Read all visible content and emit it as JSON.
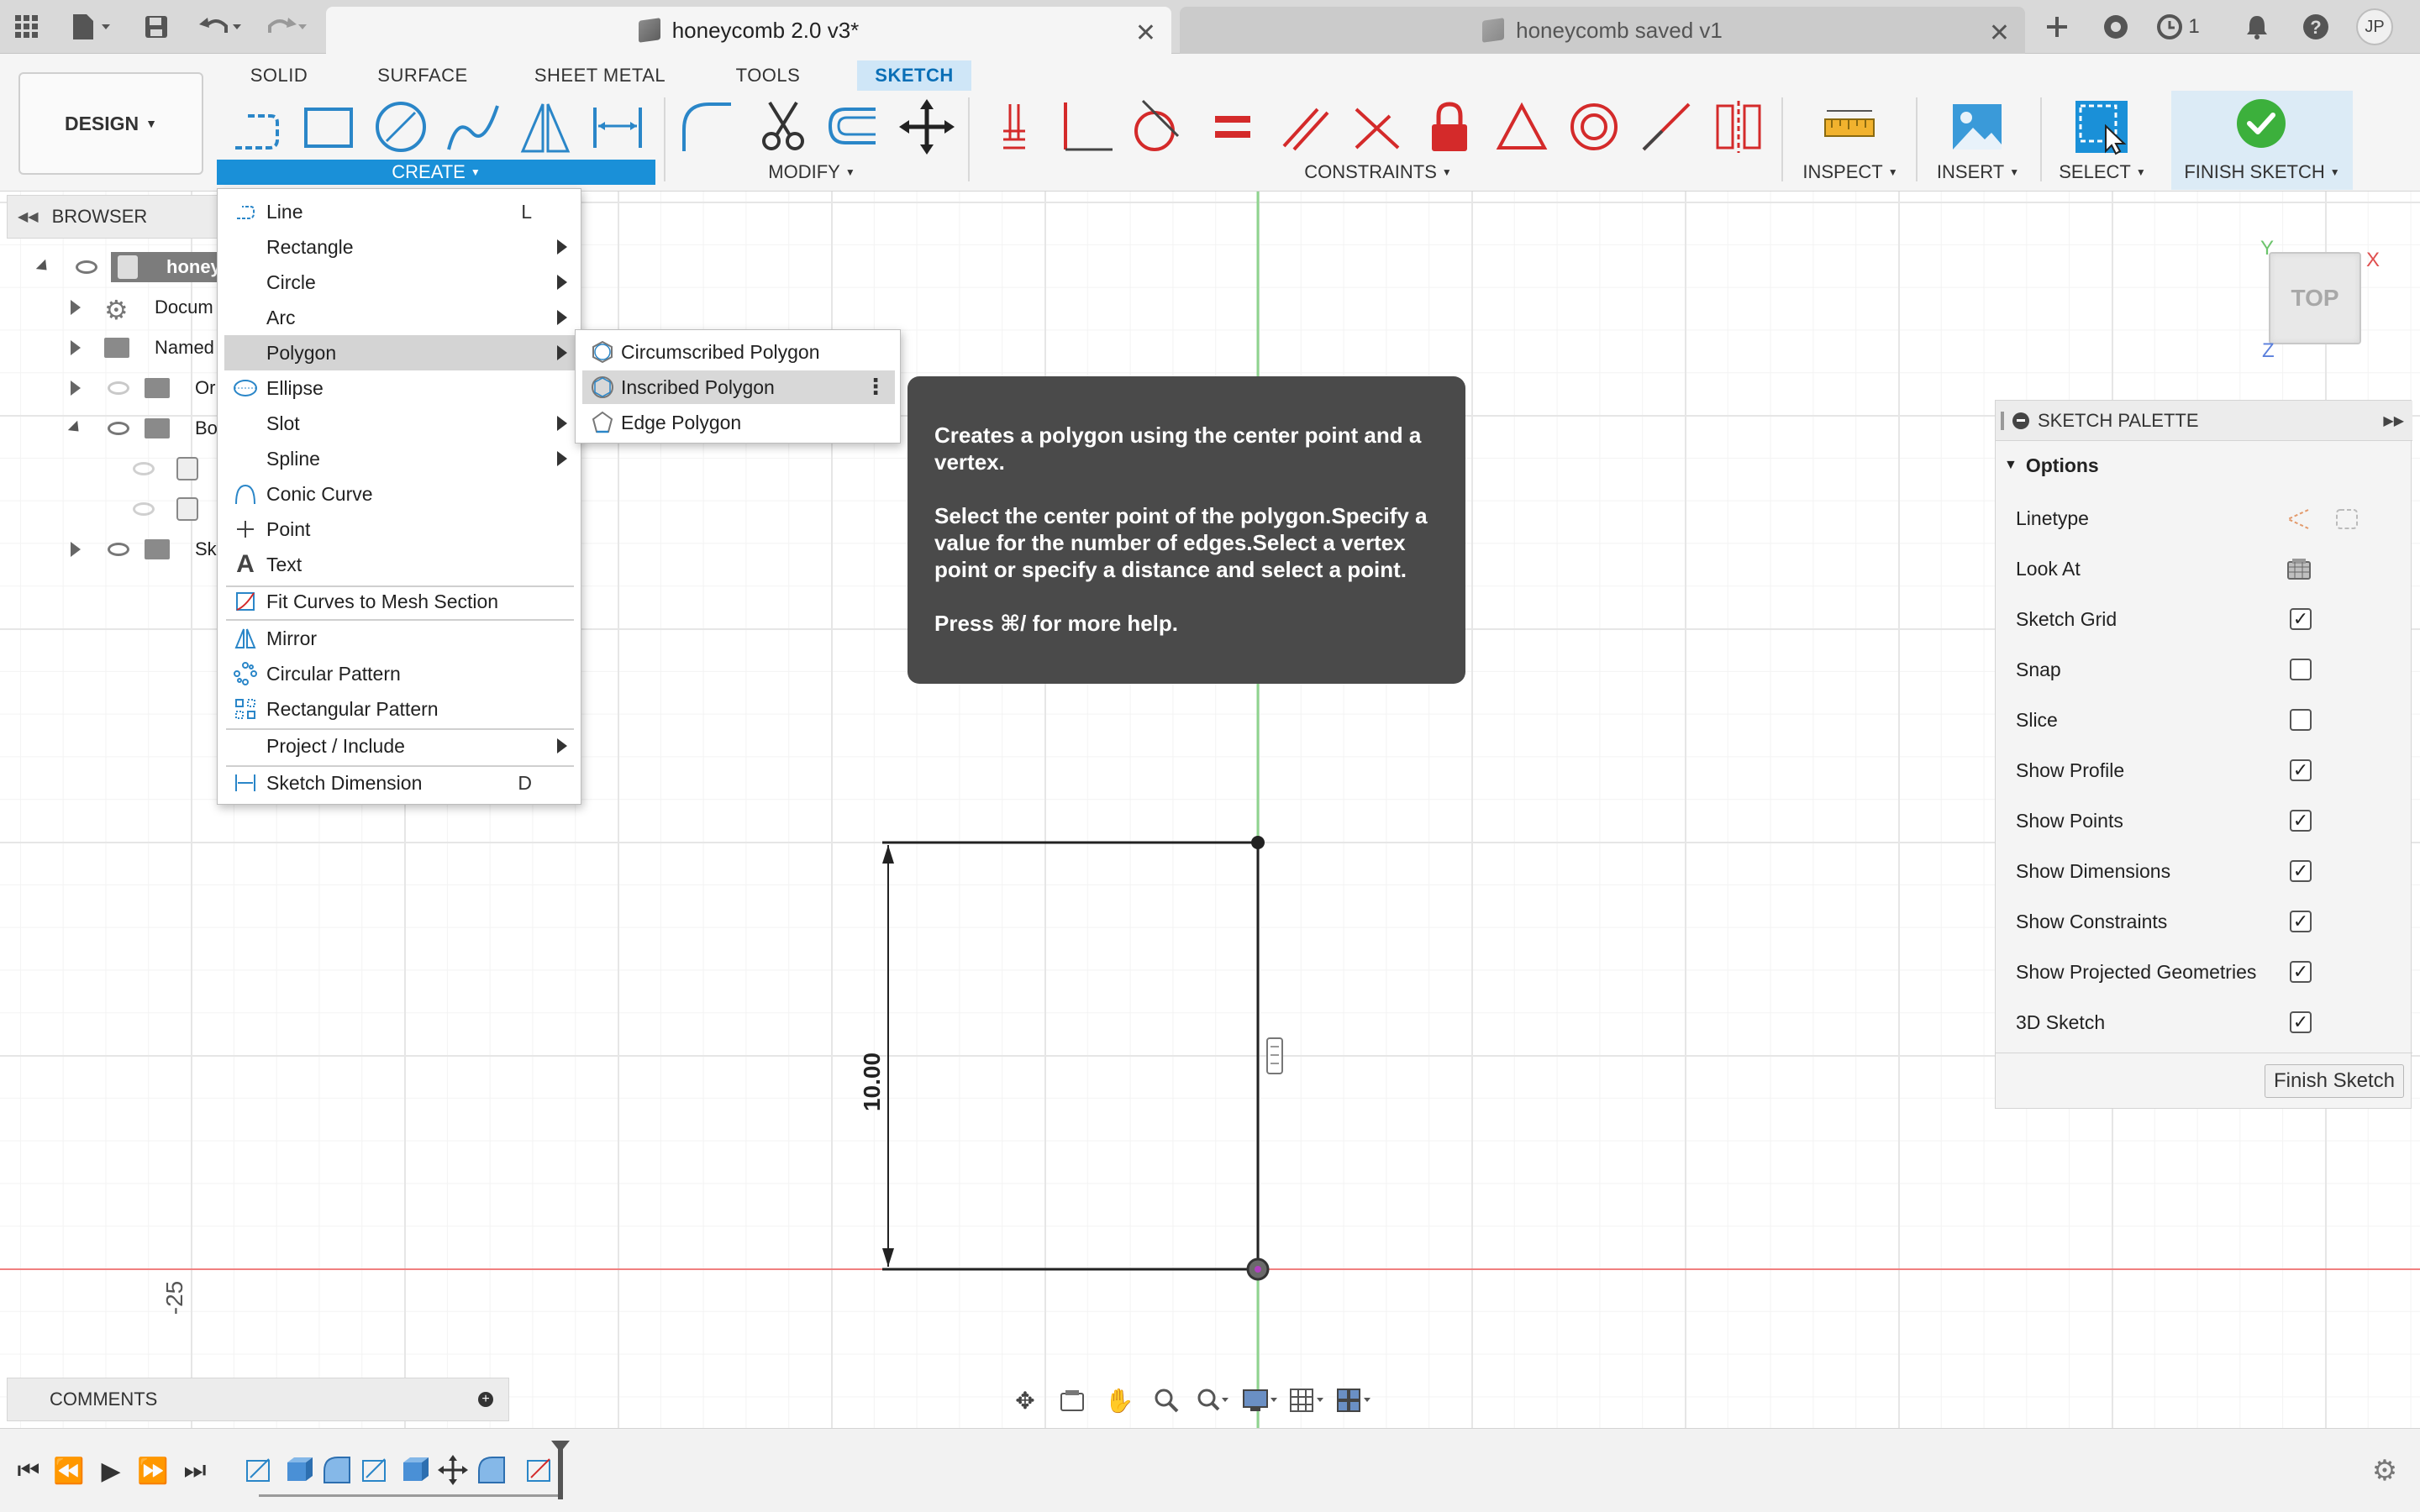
{
  "tabs": [
    {
      "title": "honeycomb 2.0 v3*",
      "active": true
    },
    {
      "title": "honeycomb saved v1",
      "active": false
    }
  ],
  "topbar": {
    "job_count": "1",
    "user_initials": "JP"
  },
  "ribbon": {
    "design_label": "DESIGN",
    "tabs": [
      "SOLID",
      "SURFACE",
      "SHEET METAL",
      "TOOLS",
      "SKETCH"
    ],
    "groups": {
      "create": "CREATE",
      "modify": "MODIFY",
      "constraints": "CONSTRAINTS",
      "inspect": "INSPECT",
      "insert": "INSERT",
      "select": "SELECT",
      "finish": "FINISH SKETCH"
    },
    "colors": {
      "accent": "#1a90d8",
      "constraint_red": "#d42a2a",
      "finish_green": "#3cb03c"
    }
  },
  "browser": {
    "title": "BROWSER",
    "items": [
      {
        "label": "honey"
      },
      {
        "label": "Docum"
      },
      {
        "label": "Named"
      },
      {
        "label": "Or"
      },
      {
        "label": "Bo"
      },
      {
        "label": "Sk"
      }
    ]
  },
  "create_menu": {
    "items": [
      {
        "label": "Line",
        "shortcut": "L"
      },
      {
        "label": "Rectangle"
      },
      {
        "label": "Circle"
      },
      {
        "label": "Arc"
      },
      {
        "label": "Polygon"
      },
      {
        "label": "Ellipse"
      },
      {
        "label": "Slot"
      },
      {
        "label": "Spline"
      },
      {
        "label": "Conic Curve"
      },
      {
        "label": "Point"
      },
      {
        "label": "Text"
      },
      {
        "label": "Fit Curves to Mesh Section"
      },
      {
        "label": "Mirror"
      },
      {
        "label": "Circular Pattern"
      },
      {
        "label": "Rectangular Pattern"
      },
      {
        "label": "Project / Include"
      },
      {
        "label": "Sketch Dimension",
        "shortcut": "D"
      }
    ]
  },
  "polygon_menu": {
    "items": [
      {
        "label": "Circumscribed Polygon"
      },
      {
        "label": "Inscribed Polygon"
      },
      {
        "label": "Edge Polygon"
      }
    ]
  },
  "tooltip": {
    "line1": "Creates a polygon using the center point and a vertex.",
    "line2": "Select the center point of the polygon.Specify a value for the number of edges.Select a vertex point or specify a distance and select a point.",
    "line3": "Press ⌘/ for more help."
  },
  "palette": {
    "title": "SKETCH PALETTE",
    "section": "Options",
    "rows": [
      {
        "label": "Linetype"
      },
      {
        "label": "Look At"
      },
      {
        "label": "Sketch Grid",
        "checked": true
      },
      {
        "label": "Snap",
        "checked": false
      },
      {
        "label": "Slice",
        "checked": false
      },
      {
        "label": "Show Profile",
        "checked": true
      },
      {
        "label": "Show Points",
        "checked": true
      },
      {
        "label": "Show Dimensions",
        "checked": true
      },
      {
        "label": "Show Constraints",
        "checked": true
      },
      {
        "label": "Show Projected Geometries",
        "checked": true
      },
      {
        "label": "3D Sketch",
        "checked": true
      }
    ],
    "finish_button": "Finish Sketch"
  },
  "canvas": {
    "dimension_label": "10.00",
    "axis_label": "-25",
    "viewcube_label": "TOP",
    "axis_x": "X",
    "axis_y": "Y",
    "axis_z": "Z"
  },
  "comments": {
    "title": "COMMENTS"
  }
}
